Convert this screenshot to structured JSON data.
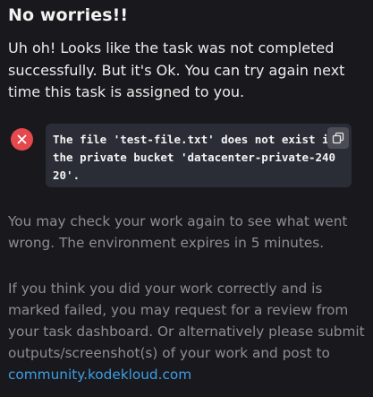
{
  "heading": "No worries!!",
  "intro": "Uh oh! Looks like the task was not completed successfully. But it's Ok. You can try again next time this task is assigned to you.",
  "error": {
    "message": "The file 'test-file.txt' does not exist in the private bucket 'datacenter-private-24020'.",
    "status_icon": "x-circle-icon",
    "copy_icon": "copy-icon",
    "color": "#e5484d"
  },
  "check_message": "You may check your work again to see what went wrong. The environment expires in 5 minutes.",
  "review_message": "If you think you did your work correctly and is marked failed, you may request for a review from your task dashboard. Or alternatively please submit outputs/screenshot(s) of your work and post to",
  "community_link": "community.kodekloud.com",
  "link_color": "#3d9ee4"
}
